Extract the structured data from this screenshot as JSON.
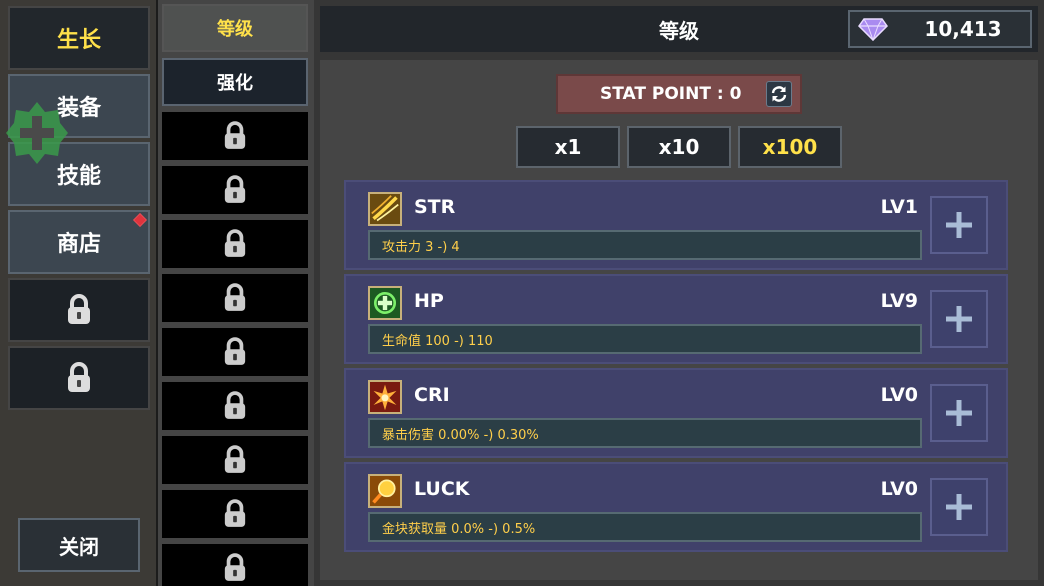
{
  "nav": {
    "items": [
      {
        "label": "生长"
      },
      {
        "label": "装备"
      },
      {
        "label": "技能"
      },
      {
        "label": "商店"
      }
    ],
    "close_label": "关闭"
  },
  "tabs": {
    "level": "等级",
    "enhance": "强化"
  },
  "header": {
    "title": "等级",
    "gems": "10,413"
  },
  "stat_point": "STAT POINT : 0",
  "multipliers": [
    "x1",
    "x10",
    "x100"
  ],
  "stats": [
    {
      "name": "STR",
      "level": "LV1",
      "desc": "攻击力 3 -) 4"
    },
    {
      "name": "HP",
      "level": "LV9",
      "desc": "生命值 100 -) 110"
    },
    {
      "name": "CRI",
      "level": "LV0",
      "desc": "暴击伤害 0.00% -) 0.30%"
    },
    {
      "name": "LUCK",
      "level": "LV0",
      "desc": "金块获取量 0.0% -) 0.5%"
    }
  ],
  "colors": {
    "accent": "#ffe14a",
    "stat_text": "#ffcf4a",
    "stat_card": "#40416a",
    "stat_point_bg": "#7a4a4a"
  },
  "icons": [
    "lock-icon",
    "gem-icon",
    "refresh-icon",
    "plus-icon",
    "str-icon",
    "hp-icon",
    "cri-icon",
    "luck-icon",
    "heal-badge-icon"
  ]
}
